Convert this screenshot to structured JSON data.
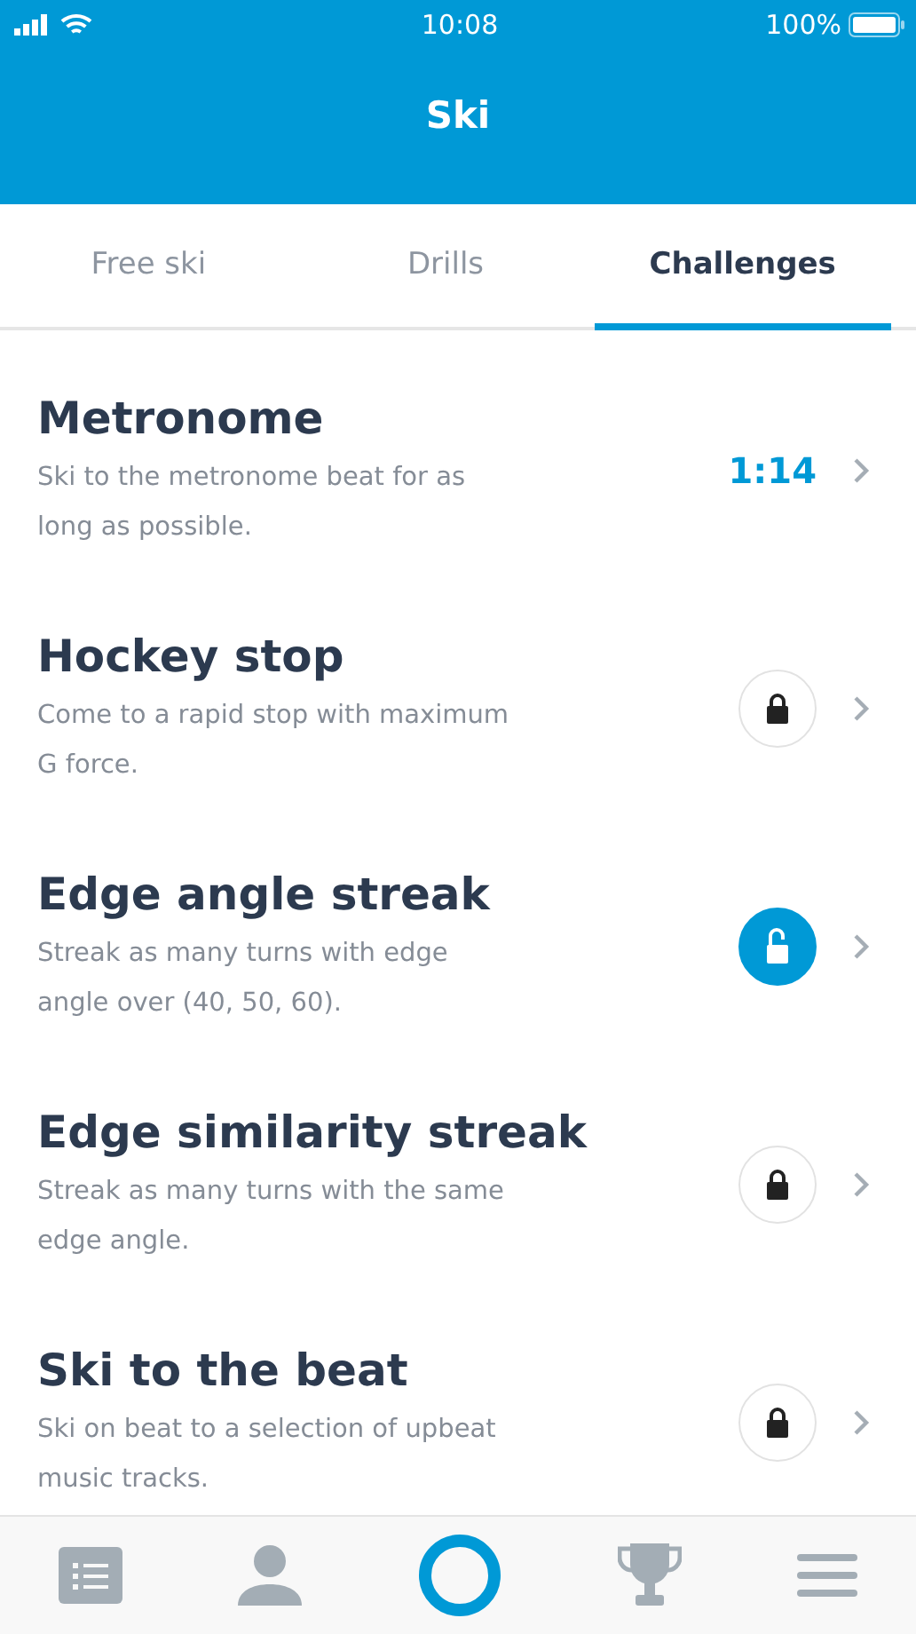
{
  "status_bar": {
    "time": "10:08",
    "battery": "100%"
  },
  "header": {
    "title": "Ski"
  },
  "tabs": [
    {
      "label": "Free ski",
      "selected": false
    },
    {
      "label": "Drills",
      "selected": false
    },
    {
      "label": "Challenges",
      "selected": true
    }
  ],
  "challenges": [
    {
      "title": "Metronome",
      "description": "Ski to the metronome beat for as long as possible.",
      "kind": "score",
      "score": "1:14"
    },
    {
      "title": "Hockey stop",
      "description": "Come to a rapid stop with maximum G force.",
      "kind": "locked"
    },
    {
      "title": "Edge angle streak",
      "description": "Streak as many turns with edge angle over (40, 50, 60).",
      "kind": "unlocked"
    },
    {
      "title": "Edge similarity streak",
      "description": "Streak as many turns with the same edge angle.",
      "kind": "locked"
    },
    {
      "title": "Ski to the beat",
      "description": "Ski on beat to a selection of upbeat music tracks.",
      "kind": "locked"
    }
  ],
  "nav": [
    {
      "kind": "list",
      "selected": false
    },
    {
      "kind": "profile",
      "selected": false
    },
    {
      "kind": "ring",
      "selected": true
    },
    {
      "kind": "trophy",
      "selected": false
    },
    {
      "kind": "menu",
      "selected": false
    }
  ]
}
